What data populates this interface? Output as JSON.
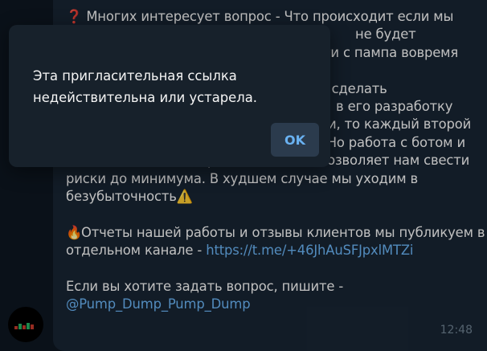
{
  "message": {
    "lines": [
      "❓ Многих интересует вопрос - Что происходит если мы",
      "не будет",
      "ти с пампа вовремя",
      "",
      "ь сделать",
      "в его разработку",
      "и, то каждый второй",
      "памп для нас заканчивался убытком. Но работа с ботом и",
      "постоянное его совершенствование позволяет нам свести",
      "риски до минимума. В худшем случае мы уходим в",
      "безубыточность⚠️"
    ],
    "reports_emoji": "🔥",
    "reports_line1": "Отчеты нашей работы и отзывы клиентов мы публикуем в",
    "reports_line2": "отдельном канале - ",
    "reports_link": "https://t.me/+46JhAuSFJpxlMTZi",
    "question_line": "Если вы хотите задать вопрос, пишите -",
    "question_handle": "@Pump_Dump_Pump_Dump",
    "time": "12:48"
  },
  "dialog": {
    "line1": "Эта пригласительная ссылка",
    "line2": "недействительна или устарела.",
    "ok_label": "OK"
  },
  "colors": {
    "background": "#0e1621",
    "bubble": "#182533",
    "dialog": "#17212b",
    "link": "#6ab2f2",
    "text": "#f5f5f5",
    "ok_button": "#2b3b4d"
  }
}
